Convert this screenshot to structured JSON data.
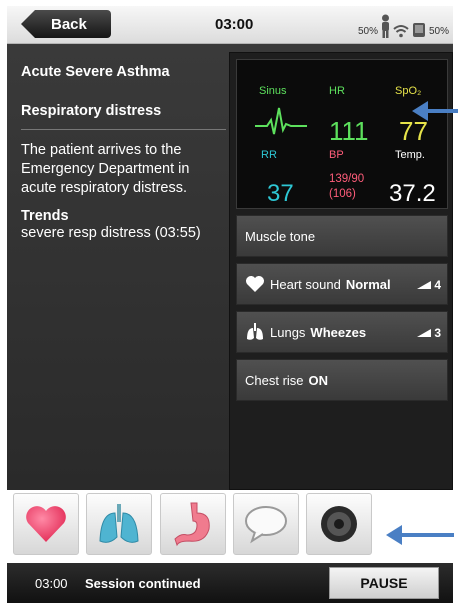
{
  "header": {
    "back_label": "Back",
    "time": "03:00",
    "signal_pct": "50%",
    "battery_pct": "50%"
  },
  "case": {
    "title": "Acute Severe Asthma",
    "subtitle": "Respiratory distress",
    "description": "The patient arrives to the Emergency Department in acute respiratory distress.",
    "trends_title": "Trends",
    "trends_text": "severe resp distress (03:55)"
  },
  "vitals": {
    "rhythm_label": "Sinus",
    "hr_label": "HR",
    "hr_value": "111",
    "spo2_label": "SpO₂",
    "spo2_value": "77",
    "rr_label": "RR",
    "rr_value": "37",
    "bp_label": "BP",
    "bp_value": "139/90",
    "bp_mean": "(106)",
    "temp_label": "Temp.",
    "temp_value": "37.2",
    "colors": {
      "hr": "#5de05d",
      "spo2": "#e6e34a",
      "rr": "#2ec7d4",
      "bp": "#ff5d7a",
      "temp": "#ffffff"
    }
  },
  "controls": {
    "muscle_tone_label": "Muscle tone",
    "heart_label": "Heart sound",
    "heart_value": "Normal",
    "heart_volume": "4",
    "lungs_label": "Lungs",
    "lungs_value": "Wheezes",
    "lungs_volume": "3",
    "chest_label": "Chest rise",
    "chest_value": "ON"
  },
  "icons": [
    "heart-icon",
    "lungs-icon",
    "stomach-icon",
    "speech-bubble-icon",
    "speaker-icon"
  ],
  "session": {
    "time": "03:00",
    "message": "Session continued",
    "pause_label": "PAUSE"
  },
  "accent_arrow_color": "#4a7fc4"
}
